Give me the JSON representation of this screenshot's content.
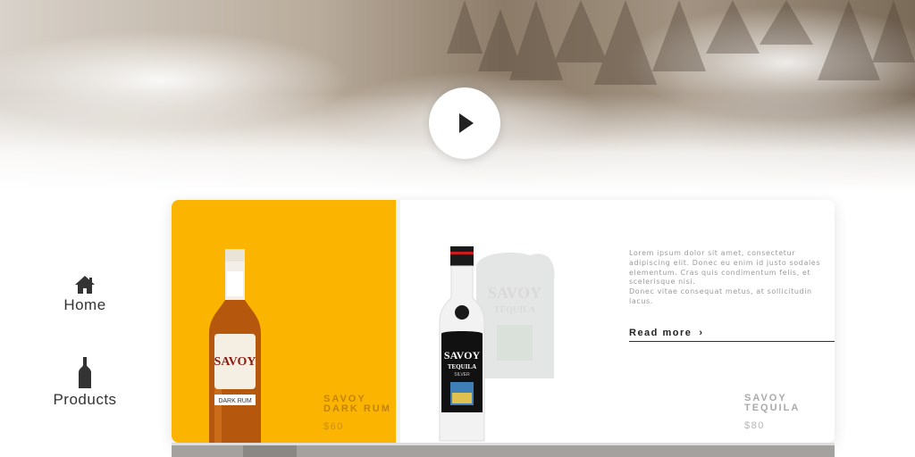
{
  "hero": {
    "play_icon": "play-icon"
  },
  "nav": {
    "items": [
      {
        "label": "Home",
        "icon": "home-icon"
      },
      {
        "label": "Products",
        "icon": "bottle-icon"
      }
    ]
  },
  "products": [
    {
      "name_line1": "SAVOY",
      "name_line2": "DARK RUM",
      "price": "$60",
      "tile_color": "#fbb400",
      "bottle_label": "SAVOY",
      "bottle_sublabel": "DARK RUM"
    },
    {
      "name_line1": "SAVOY",
      "name_line2": "TEQUILA",
      "price": "$80",
      "bottle_label": "SAVOY",
      "bottle_sublabel": "TEQUILA",
      "bottle_sublabel2": "SILVER"
    }
  ],
  "description": {
    "text": "Lorem ipsum dolor sit amet, consectetur adipiscing elit. Donec eu enim id justo sodales elementum. Cras quis condimentum felis, et scelerisque nisi.",
    "text2": "Donec vitae consequat metus, at sollicitudin lacus."
  },
  "read_more": {
    "label": "Read more",
    "icon": "chevron-right-icon"
  },
  "colors": {
    "accent": "#fbb400",
    "text_dark": "#333333"
  }
}
